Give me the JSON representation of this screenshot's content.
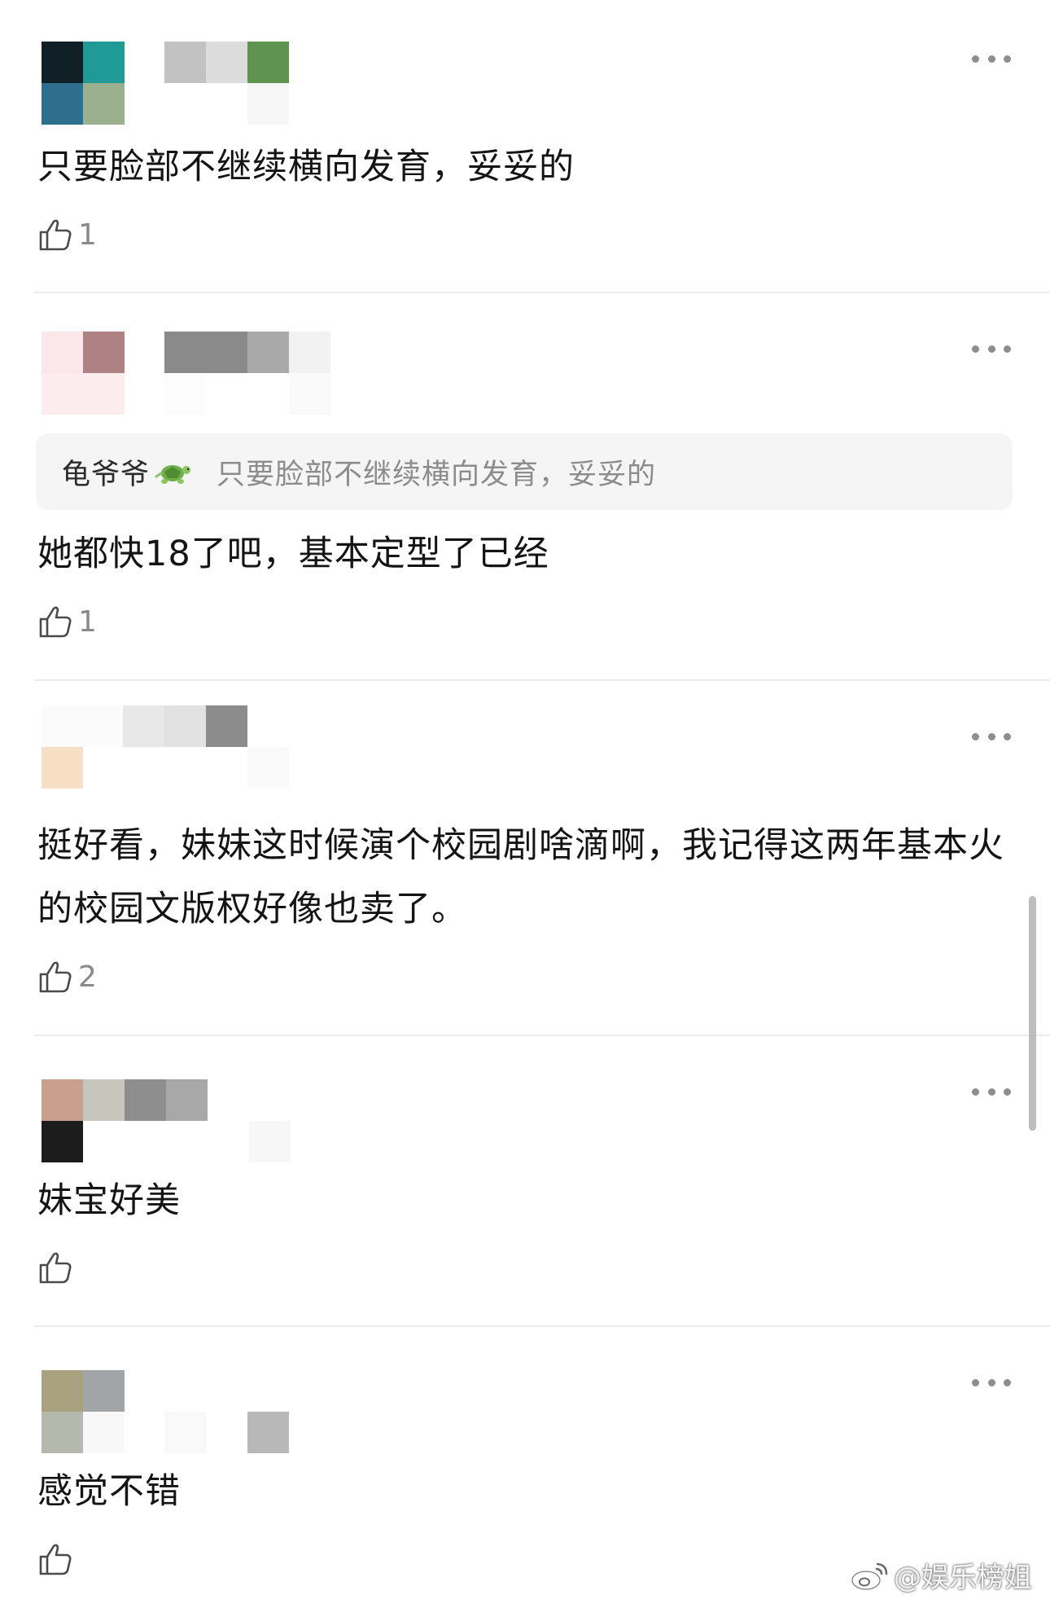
{
  "comments": [
    {
      "text": "只要脸部不继续横向发育，妥妥的",
      "likes": "1",
      "reply_to": null
    },
    {
      "text": "她都快18了吧，基本定型了已经",
      "likes": "1",
      "reply_to": {
        "name": "龟爷爷",
        "text": "只要脸部不继续横向发育，妥妥的"
      }
    },
    {
      "text": "挺好看，妹妹这时候演个校园剧啥滴啊，我记得这两年基本火的校园文版权好像也卖了。",
      "likes": "2",
      "reply_to": null
    },
    {
      "text": "妹宝好美",
      "likes": "",
      "reply_to": null
    },
    {
      "text": "感觉不错",
      "likes": "",
      "reply_to": null
    }
  ],
  "icons": {
    "more": "more-dots-icon",
    "like": "thumbs-up-icon",
    "quote_emoji": "turtle-icon",
    "watermark": "weibo-logo-icon"
  },
  "watermark": {
    "text": "@娱乐榜姐"
  },
  "colors": {
    "text": "#141414",
    "muted": "#8a8a8a",
    "quote_bg": "#f5f5f5",
    "divider": "#ececec"
  }
}
